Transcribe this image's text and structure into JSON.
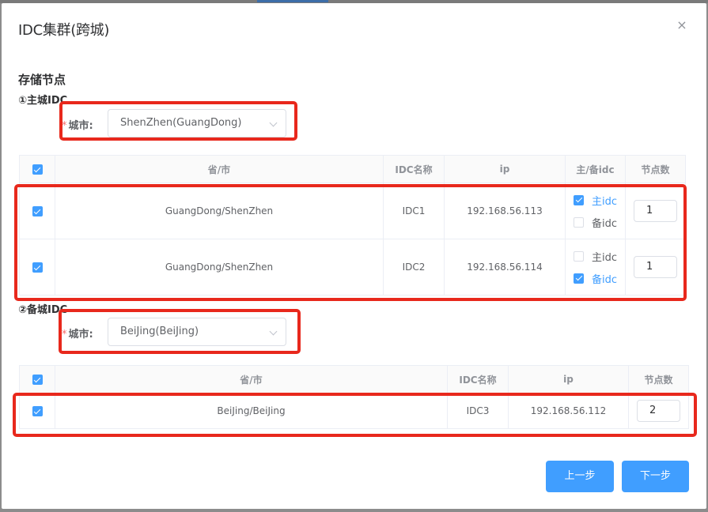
{
  "dialog": {
    "title": "IDC集群(跨城)",
    "close_glyph": "×"
  },
  "section": {
    "title": "存储节点"
  },
  "primary": {
    "subtitle": "①主城IDC",
    "city_label": "城市:",
    "required_mark": "*",
    "city_value": "ShenZhen(GuangDong)",
    "columns": [
      "省/市",
      "IDC名称",
      "ip",
      "主/备idc",
      "节点数"
    ],
    "rows": [
      {
        "checked": true,
        "region": "GuangDong/ShenZhen",
        "idc": "IDC1",
        "ip": "192.168.56.113",
        "main_label": "主idc",
        "main_checked": true,
        "backup_label": "备idc",
        "backup_checked": false,
        "nodes": "1"
      },
      {
        "checked": true,
        "region": "GuangDong/ShenZhen",
        "idc": "IDC2",
        "ip": "192.168.56.114",
        "main_label": "主idc",
        "main_checked": false,
        "backup_label": "备idc",
        "backup_checked": true,
        "nodes": "1"
      }
    ]
  },
  "backup": {
    "subtitle": "②备城IDC",
    "city_label": "城市:",
    "required_mark": "*",
    "city_value": "BeiJing(BeiJing)",
    "columns": [
      "省/市",
      "IDC名称",
      "ip",
      "节点数"
    ],
    "rows": [
      {
        "checked": true,
        "region": "BeiJing/BeiJing",
        "idc": "IDC3",
        "ip": "192.168.56.112",
        "nodes": "2"
      }
    ]
  },
  "footer": {
    "prev_label": "上一步",
    "next_label": "下一步"
  },
  "colors": {
    "accent": "#409eff",
    "highlight_box": "#e8281c",
    "required": "#f56c6c"
  },
  "icons": {
    "close": "close-icon",
    "dropdown": "chevron-down-icon",
    "checkbox": "checkbox-icon"
  }
}
